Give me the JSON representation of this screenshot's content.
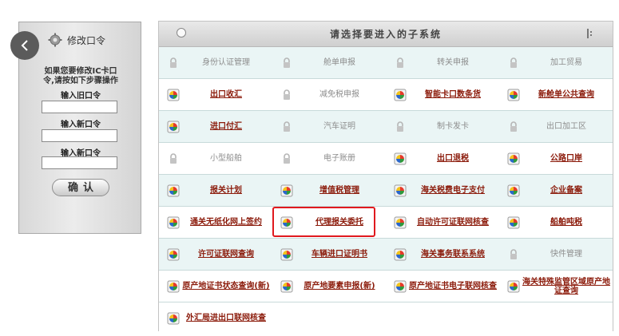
{
  "left_panel": {
    "title": "修改口令",
    "note_line1": "如果您要修改IC卡口",
    "note_line2": "令,请按如下步骤操作",
    "label_old": "输入旧口令",
    "label_new": "输入新口令",
    "label_new_confirm": "输入新口令",
    "confirm_button": "确认"
  },
  "right_panel": {
    "title": "请选择要进入的子系统",
    "rows": [
      [
        {
          "label": "身份认证管理",
          "enabled": false
        },
        {
          "label": "舱单申报",
          "enabled": false
        },
        {
          "label": "转关申报",
          "enabled": false
        },
        {
          "label": "加工贸易",
          "enabled": false
        }
      ],
      [
        {
          "label": "出口收汇",
          "enabled": true
        },
        {
          "label": "减免税申报",
          "enabled": false
        },
        {
          "label": "智能卡口数条货",
          "enabled": true
        },
        {
          "label": "新舱单公共查询",
          "enabled": true
        }
      ],
      [
        {
          "label": "进口付汇",
          "enabled": true
        },
        {
          "label": "汽车证明",
          "enabled": false
        },
        {
          "label": "制卡发卡",
          "enabled": false
        },
        {
          "label": "出口加工区",
          "enabled": false
        }
      ],
      [
        {
          "label": "小型船舶",
          "enabled": false
        },
        {
          "label": "电子账册",
          "enabled": false
        },
        {
          "label": "出口退税",
          "enabled": true
        },
        {
          "label": "公路口岸",
          "enabled": true
        }
      ],
      [
        {
          "label": "报关计划",
          "enabled": true
        },
        {
          "label": "增值税管理",
          "enabled": true
        },
        {
          "label": "海关税费电子支付",
          "enabled": true
        },
        {
          "label": "企业备案",
          "enabled": true
        }
      ],
      [
        {
          "label": "通关无纸化网上签约",
          "enabled": true
        },
        {
          "label": "代理报关委托",
          "enabled": true
        },
        {
          "label": "自动许可证联网核查",
          "enabled": true
        },
        {
          "label": "船舶吨税",
          "enabled": true
        }
      ],
      [
        {
          "label": "许可证联网查询",
          "enabled": true
        },
        {
          "label": "车辆进口证明书",
          "enabled": true
        },
        {
          "label": "海关事务联系系统",
          "enabled": true
        },
        {
          "label": "快件管理",
          "enabled": false
        }
      ],
      [
        {
          "label": "原产地证书状态查询(新)",
          "enabled": true
        },
        {
          "label": "原产地要素申报(新)",
          "enabled": true
        },
        {
          "label": "原产地证书电子联网核查",
          "enabled": true
        },
        {
          "label": "海关特殊监管区域原产地证查询",
          "enabled": true
        }
      ],
      [
        {
          "label": "外汇局进出口联网核查",
          "enabled": true
        }
      ]
    ]
  }
}
